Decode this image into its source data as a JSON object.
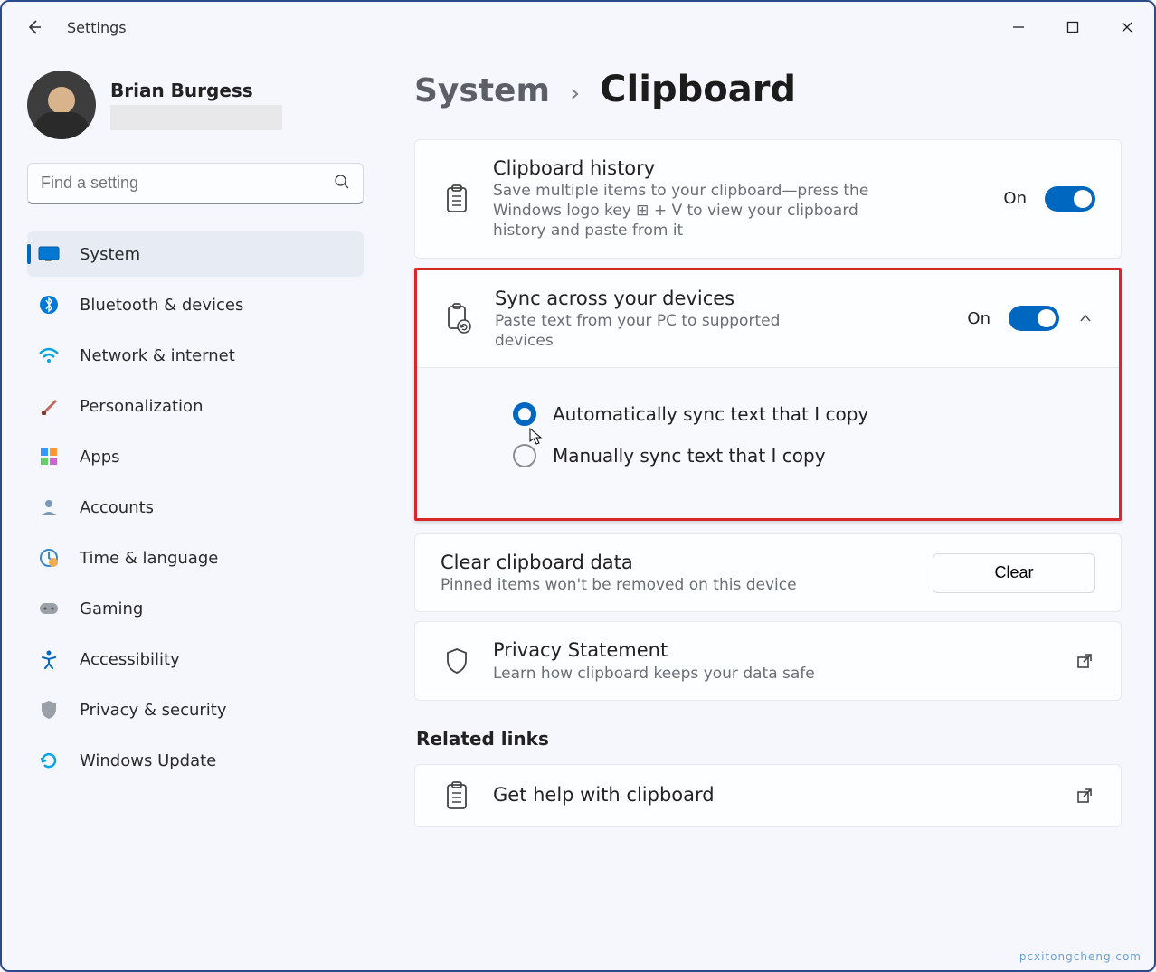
{
  "window": {
    "app_title": "Settings"
  },
  "profile": {
    "name": "Brian Burgess"
  },
  "search": {
    "placeholder": "Find a setting"
  },
  "sidebar": {
    "items": [
      {
        "label": "System",
        "active": true
      },
      {
        "label": "Bluetooth & devices"
      },
      {
        "label": "Network & internet"
      },
      {
        "label": "Personalization"
      },
      {
        "label": "Apps"
      },
      {
        "label": "Accounts"
      },
      {
        "label": "Time & language"
      },
      {
        "label": "Gaming"
      },
      {
        "label": "Accessibility"
      },
      {
        "label": "Privacy & security"
      },
      {
        "label": "Windows Update"
      }
    ]
  },
  "breadcrumb": {
    "parent": "System",
    "current": "Clipboard"
  },
  "settings": {
    "clipboard_history": {
      "title": "Clipboard history",
      "desc": "Save multiple items to your clipboard—press the Windows logo key ⊞ + V to view your clipboard history and paste from it",
      "state": "On"
    },
    "sync": {
      "title": "Sync across your devices",
      "desc": "Paste text from your PC to supported devices",
      "state": "On",
      "option_auto": "Automatically sync text that I copy",
      "option_manual": "Manually sync text that I copy"
    },
    "clear": {
      "title": "Clear clipboard data",
      "desc": "Pinned items won't be removed on this device",
      "button": "Clear"
    },
    "privacy": {
      "title": "Privacy Statement",
      "desc": "Learn how clipboard keeps your data safe"
    }
  },
  "related": {
    "heading": "Related links",
    "help": "Get help with clipboard"
  },
  "watermark": "pcxitongcheng.com"
}
